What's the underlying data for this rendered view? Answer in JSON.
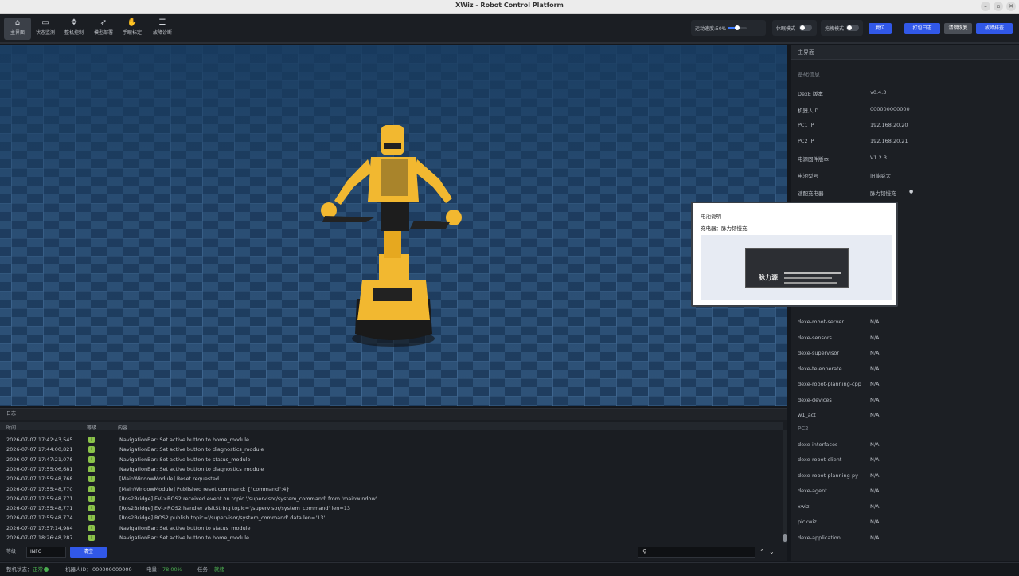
{
  "window": {
    "title": "XWiz - Robot Control Platform"
  },
  "nav": [
    {
      "label": "主界面",
      "icon": "home-icon",
      "glyph": "⌂"
    },
    {
      "label": "状态监测",
      "icon": "monitor-icon",
      "glyph": "▭"
    },
    {
      "label": "整机控制",
      "icon": "control-icon",
      "glyph": "✥"
    },
    {
      "label": "模型部署",
      "icon": "rocket-icon",
      "glyph": "➶"
    },
    {
      "label": "手眼标定",
      "icon": "calibration-icon",
      "glyph": "✋"
    },
    {
      "label": "故障诊断",
      "icon": "diagnostics-icon",
      "glyph": "☰"
    }
  ],
  "toolbar": {
    "speed_label": "运动速度:50%",
    "speed_value": 0.5,
    "pause_label": "休眠模式",
    "drag_label": "拖拽模式",
    "reset_label": "复位",
    "pack_logs_label": "打包日志",
    "clear_error_label": "清错恢复",
    "fault_clear_label": "故障排查"
  },
  "viewport": {
    "name": "3d-robot-view"
  },
  "right_panel": {
    "header": "主界面",
    "basic_title": "基础信息",
    "basic": [
      {
        "k": "DexE 版本",
        "v": "v0.4.3"
      },
      {
        "k": "机器人ID",
        "v": "000000000000"
      },
      {
        "k": "PC1 IP",
        "v": "192.168.20.20"
      },
      {
        "k": "PC2 IP",
        "v": "192.168.20.21"
      },
      {
        "k": "电源固件版本",
        "v": "V1.2.3"
      },
      {
        "k": "电池型号",
        "v": "旧能威大"
      },
      {
        "k": "适配充电器",
        "v": "脉力韧慢充"
      }
    ],
    "pc1_modules": [
      {
        "k": "dexe-robot-server",
        "v": "N/A"
      },
      {
        "k": "dexe-sensors",
        "v": "N/A"
      },
      {
        "k": "dexe-supervisor",
        "v": "N/A"
      },
      {
        "k": "dexe-teleoperate",
        "v": "N/A"
      },
      {
        "k": "dexe-robot-planning-cpp",
        "v": "N/A"
      },
      {
        "k": "dexe-devices",
        "v": "N/A"
      },
      {
        "k": "w1_act",
        "v": "N/A"
      }
    ],
    "pc2_title": "PC2",
    "pc2_modules": [
      {
        "k": "dexe-interfaces",
        "v": "N/A"
      },
      {
        "k": "dexe-robot-client",
        "v": "N/A"
      },
      {
        "k": "dexe-robot-planning-py",
        "v": "N/A"
      },
      {
        "k": "dexe-agent",
        "v": "N/A"
      },
      {
        "k": "xwiz",
        "v": "N/A"
      },
      {
        "k": "pickwiz",
        "v": "N/A"
      },
      {
        "k": "dexe-application",
        "v": "N/A"
      }
    ]
  },
  "popup": {
    "title": "电池说明",
    "line": "充电器：脉力韧慢充",
    "brand": "脉力源"
  },
  "log": {
    "title": "日志",
    "col_time": "时间",
    "col_level": "等级",
    "col_content": "内容",
    "rows": [
      {
        "t": "2026-07-07 17:42:43,545",
        "c": "NavigationBar: Set active button to home_module"
      },
      {
        "t": "2026-07-07 17:44:00,821",
        "c": "NavigationBar: Set active button to diagnostics_module"
      },
      {
        "t": "2026-07-07 17:47:21,078",
        "c": "NavigationBar: Set active button to status_module"
      },
      {
        "t": "2026-07-07 17:55:06,681",
        "c": "NavigationBar: Set active button to diagnostics_module"
      },
      {
        "t": "2026-07-07 17:55:48,768",
        "c": "[MainWindowModule] Reset requested"
      },
      {
        "t": "2026-07-07 17:55:48,770",
        "c": "[MainWindowModule] Published reset command: {\"command\":4}"
      },
      {
        "t": "2026-07-07 17:55:48,771",
        "c": "[Ros2Bridge] EV->ROS2 received event on topic '/supervisor/system_command' from 'mainwindow'"
      },
      {
        "t": "2026-07-07 17:55:48,771",
        "c": "[Ros2Bridge] EV->ROS2 handler visitString topic='/supervisor/system_command' len=13"
      },
      {
        "t": "2026-07-07 17:55:48,774",
        "c": "[Ros2Bridge] ROS2 publish topic='/supervisor/system_command' data len='13'"
      },
      {
        "t": "2026-07-07 17:57:14,984",
        "c": "NavigationBar: Set active button to status_module"
      },
      {
        "t": "2026-07-07 18:26:48,287",
        "c": "NavigationBar: Set active button to home_module"
      }
    ],
    "level_label": "等级",
    "level_value": "INFO",
    "clear_label": "清空"
  },
  "status": {
    "state_label": "整机状态：",
    "state_value": "正常",
    "state_color": "#4caf50",
    "robot_id_label": "机器人ID：",
    "robot_id_value": "000000000000",
    "battery_label": "电量：",
    "battery_value": "78.00%",
    "task_label": "任务：",
    "task_value": "就绪",
    "value_color": "#4caf50"
  }
}
